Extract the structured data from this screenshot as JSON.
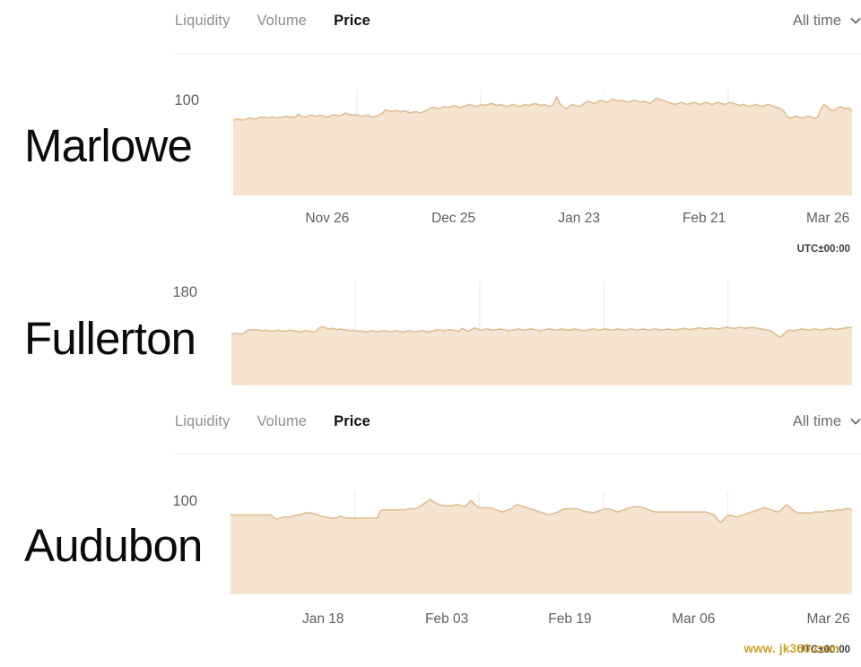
{
  "tabs_common": {
    "items": [
      "Liquidity",
      "Volume",
      "Price"
    ],
    "active": "Price",
    "range_label": "All time",
    "chevron_icon": "chevron-down-icon"
  },
  "utc_note": "UTC±00:00",
  "watermark": "www. jk360.com",
  "colors": {
    "area_fill": "#f5e4cf",
    "area_stroke": "#dfbe93",
    "gridline": "#eeeae4",
    "divider": "#ececec",
    "tab_inactive": "#8e8e93",
    "tab_active": "#111111",
    "axis_text": "#5f5f64",
    "watermark": "#c9a227"
  },
  "cards": [
    {
      "name": "Marlowe",
      "y_max_label": "100",
      "x_ticks": [
        "Nov 26",
        "Dec 25",
        "Jan 23",
        "Feb 21",
        "Mar 26"
      ],
      "has_tabbar": true,
      "has_xaxis": true,
      "has_utc": true
    },
    {
      "name": "Fullerton",
      "y_max_label": "180",
      "x_ticks": [],
      "has_tabbar": false,
      "has_xaxis": false,
      "has_utc": false
    },
    {
      "name": "Audubon",
      "y_max_label": "100",
      "x_ticks": [
        "Jan 18",
        "Feb 03",
        "Feb 19",
        "Mar 06",
        "Mar 26"
      ],
      "has_tabbar": false,
      "has_xaxis": true,
      "has_utc": true
    }
  ],
  "chart_data": [
    {
      "type": "area",
      "title": "Marlowe",
      "xlabel": "",
      "ylabel": "",
      "ylim": [
        0,
        100
      ],
      "y_ticks": [
        100
      ],
      "grid": true,
      "legend": "none",
      "x_tick_labels": [
        "Nov 26",
        "Dec 25",
        "Jan 23",
        "Feb 21",
        "Mar 26"
      ],
      "series": [
        {
          "name": "Price",
          "values": [
            71,
            72,
            72,
            71,
            72,
            73,
            73,
            72,
            73,
            74,
            74,
            73,
            74,
            74,
            73,
            74,
            74,
            75,
            74,
            74,
            74,
            77,
            75,
            74,
            75,
            76,
            75,
            75,
            76,
            75,
            74,
            75,
            76,
            76,
            75,
            76,
            78,
            77,
            76,
            76,
            76,
            75,
            75,
            76,
            75,
            74,
            75,
            76,
            78,
            81,
            80,
            79,
            80,
            80,
            79,
            80,
            79,
            78,
            79,
            79,
            78,
            79,
            80,
            82,
            83,
            83,
            82,
            83,
            84,
            83,
            84,
            85,
            84,
            83,
            84,
            85,
            86,
            85,
            84,
            85,
            86,
            85,
            86,
            87,
            86,
            85,
            86,
            85,
            84,
            85,
            86,
            85,
            84,
            85,
            86,
            85,
            86,
            87,
            86,
            85,
            86,
            85,
            84,
            86,
            93,
            87,
            84,
            82,
            84,
            86,
            85,
            84,
            85,
            87,
            89,
            88,
            87,
            88,
            90,
            89,
            88,
            89,
            91,
            90,
            89,
            90,
            89,
            88,
            89,
            90,
            89,
            88,
            89,
            88,
            87,
            89,
            92,
            91,
            90,
            89,
            88,
            87,
            86,
            87,
            88,
            87,
            86,
            87,
            88,
            87,
            86,
            87,
            88,
            87,
            86,
            87,
            88,
            87,
            86,
            87,
            88,
            87,
            86,
            85,
            86,
            85,
            84,
            85,
            86,
            85,
            84,
            85,
            86,
            85,
            84,
            83,
            82,
            80,
            75,
            73,
            74,
            75,
            74,
            73,
            74,
            75,
            74,
            73,
            74,
            82,
            86,
            84,
            81,
            80,
            82,
            84,
            83,
            82,
            83,
            80
          ]
        }
      ]
    },
    {
      "type": "area",
      "title": "Fullerton",
      "xlabel": "",
      "ylabel": "",
      "ylim": [
        0,
        180
      ],
      "y_ticks": [
        180
      ],
      "grid": true,
      "legend": "none",
      "x_tick_labels": [],
      "series": [
        {
          "name": "Price",
          "values": [
            88,
            89,
            89,
            88,
            89,
            95,
            96,
            95,
            96,
            95,
            94,
            95,
            94,
            93,
            94,
            95,
            94,
            93,
            94,
            95,
            94,
            93,
            92,
            93,
            94,
            93,
            92,
            93,
            98,
            101,
            99,
            97,
            98,
            97,
            96,
            97,
            96,
            95,
            94,
            95,
            93,
            94,
            93,
            92,
            93,
            94,
            93,
            92,
            93,
            94,
            93,
            92,
            93,
            94,
            93,
            92,
            93,
            94,
            93,
            92,
            93,
            94,
            93,
            92,
            93,
            94,
            96,
            95,
            94,
            95,
            96,
            95,
            94,
            93,
            98,
            95,
            93,
            96,
            99,
            97,
            95,
            96,
            97,
            96,
            95,
            96,
            97,
            96,
            95,
            94,
            95,
            96,
            97,
            96,
            95,
            96,
            97,
            96,
            95,
            94,
            95,
            96,
            97,
            96,
            95,
            96,
            97,
            96,
            95,
            96,
            97,
            96,
            95,
            94,
            95,
            96,
            97,
            96,
            95,
            96,
            97,
            96,
            95,
            96,
            97,
            96,
            95,
            96,
            97,
            96,
            95,
            96,
            97,
            96,
            95,
            96,
            97,
            96,
            95,
            96,
            97,
            96,
            95,
            96,
            97,
            98,
            97,
            96,
            97,
            98,
            99,
            98,
            97,
            98,
            99,
            98,
            97,
            98,
            99,
            100,
            99,
            98,
            99,
            100,
            99,
            98,
            99,
            100,
            99,
            98,
            97,
            96,
            95,
            94,
            90,
            86,
            83,
            88,
            93,
            95,
            94,
            95,
            96,
            97,
            96,
            95,
            96,
            97,
            96,
            95,
            96,
            97,
            98,
            97,
            96,
            97,
            98,
            99,
            100,
            99
          ]
        }
      ]
    },
    {
      "type": "area",
      "title": "Audubon",
      "xlabel": "",
      "ylabel": "",
      "ylim": [
        0,
        100
      ],
      "y_ticks": [
        100
      ],
      "grid": true,
      "legend": "none",
      "x_tick_labels": [
        "Jan 18",
        "Feb 03",
        "Feb 19",
        "Mar 06",
        "Mar 26"
      ],
      "series": [
        {
          "name": "Price",
          "values": [
            77,
            77,
            77,
            77,
            77,
            77,
            77,
            77,
            77,
            77,
            77,
            77,
            77,
            77,
            74,
            73,
            74,
            75,
            75,
            75,
            76,
            77,
            77,
            78,
            79,
            79,
            79,
            78,
            77,
            76,
            75,
            75,
            74,
            74,
            74,
            76,
            75,
            74,
            74,
            74,
            74,
            74,
            74,
            74,
            74,
            74,
            74,
            74,
            81,
            82,
            82,
            82,
            82,
            82,
            82,
            82,
            82,
            83,
            83,
            83,
            84,
            86,
            88,
            90,
            92,
            90,
            88,
            87,
            86,
            86,
            86,
            86,
            87,
            87,
            86,
            85,
            88,
            91,
            88,
            85,
            84,
            84,
            84,
            84,
            83,
            82,
            81,
            80,
            81,
            82,
            83,
            86,
            87,
            86,
            85,
            84,
            83,
            82,
            81,
            80,
            79,
            78,
            77,
            78,
            79,
            80,
            82,
            83,
            83,
            83,
            83,
            83,
            82,
            81,
            80,
            80,
            79,
            80,
            81,
            82,
            83,
            83,
            82,
            81,
            80,
            81,
            82,
            83,
            84,
            85,
            85,
            85,
            84,
            83,
            82,
            81,
            80,
            80,
            80,
            80,
            80,
            80,
            80,
            80,
            80,
            80,
            80,
            80,
            80,
            80,
            80,
            80,
            80,
            79,
            78,
            77,
            72,
            70,
            73,
            76,
            77,
            76,
            75,
            76,
            77,
            78,
            79,
            80,
            81,
            82,
            83,
            84,
            83,
            82,
            81,
            80,
            81,
            84,
            87,
            85,
            82,
            80,
            79,
            79,
            79,
            79,
            79,
            80,
            80,
            80,
            80,
            81,
            81,
            81,
            82,
            82,
            82,
            83,
            83,
            82
          ]
        }
      ]
    }
  ]
}
